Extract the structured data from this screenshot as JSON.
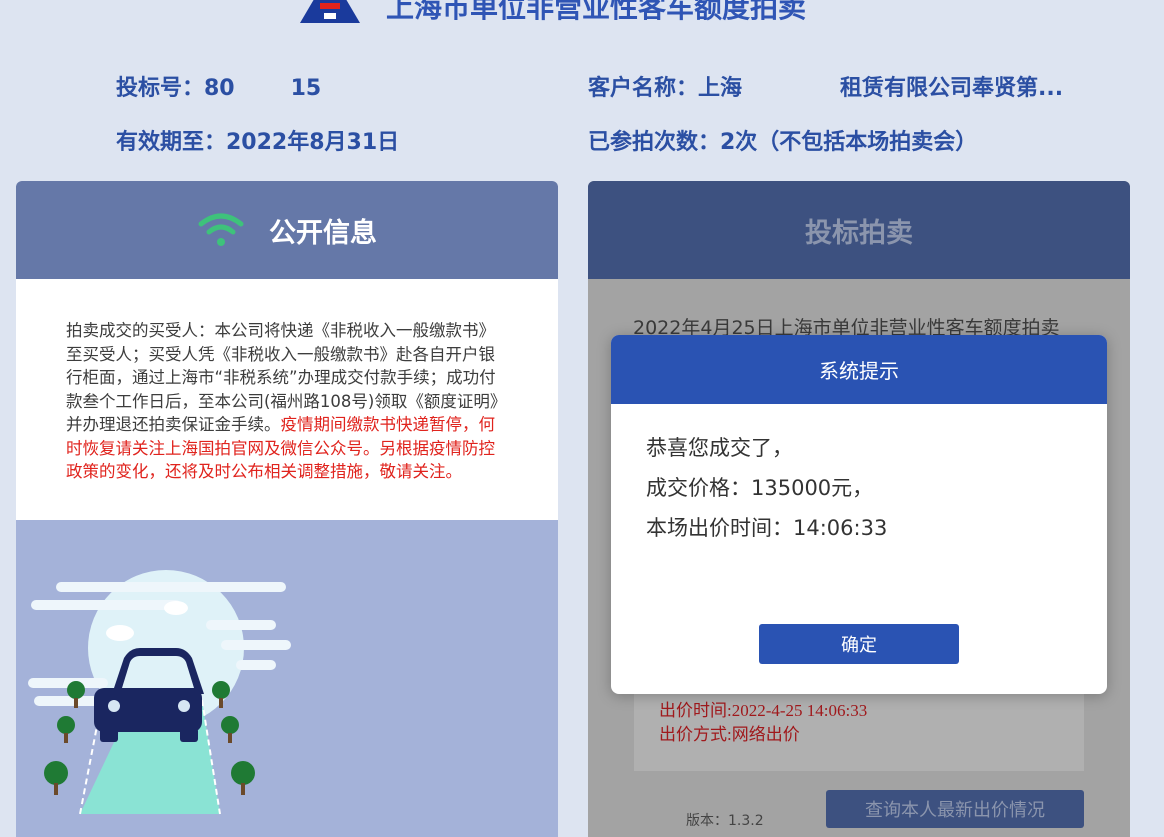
{
  "header": {
    "title": "上海市单位非营业性客车额度拍卖",
    "logo_colors": [
      "#1a3a9c",
      "#e0231d"
    ]
  },
  "info": {
    "bid_no_label": "投标号：80",
    "bid_no_tail": "15",
    "expiry": "有效期至：2022年8月31日",
    "customer_left": "客户名称：上海",
    "customer_right": "租赁有限公司奉贤第...",
    "attempts": "已参拍次数：2次（不包括本场拍卖会）"
  },
  "left_panel": {
    "title": "公开信息",
    "icon": "wifi-icon",
    "notice_black": "拍卖成交的买受人：本公司将快递《非税收入一般缴款书》至买受人；买受人凭《非税收入一般缴款书》赴各自开户银行柜面，通过上海市“非税系统”办理成交付款手续；成功付款叁个工作日后，至本公司(福州路108号)领取《额度证明》并办理退还拍卖保证金手续。",
    "notice_red": "疫情期间缴款书快递暂停，何时恢复请关注上海国拍官网及微信公众号。另根据疫情防控政策的变化，还将及时公布相关调整措施，敬请关注。"
  },
  "right_panel": {
    "title": "投标拍卖",
    "auction_name": "2022年4月25日上海市单位非营业性客车额度拍卖",
    "bid_time": "出价时间:2022-4-25 14:06:33",
    "bid_method": "出价方式:网络出价",
    "version": "版本：1.3.2",
    "query_button": "查询本人最新出价情况"
  },
  "dialog": {
    "title": "系统提示",
    "line1": "恭喜您成交了，",
    "line2": "成交价格：135000元，",
    "line3": "本场出价时间：14:06:33",
    "ok_button": "确定"
  },
  "colors": {
    "accent": "#2a53b3",
    "background": "#dde4f1",
    "red_text": "#e0231d"
  }
}
